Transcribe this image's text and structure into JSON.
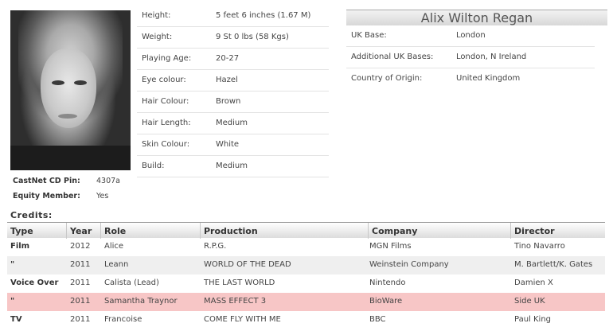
{
  "profile": {
    "name": "Alix Wilton Regan",
    "castnet_pin_label": "CastNet CD Pin:",
    "castnet_pin": "4307a",
    "equity_label": "Equity Member:",
    "equity": "Yes"
  },
  "attributes": [
    {
      "label": "Height:",
      "value": "5 feet 6 inches (1.67 M)"
    },
    {
      "label": "Weight:",
      "value": "9 St 0 lbs (58 Kgs)"
    },
    {
      "label": "Playing Age:",
      "value": "20-27"
    },
    {
      "label": "Eye colour:",
      "value": "Hazel"
    },
    {
      "label": "Hair Colour:",
      "value": "Brown"
    },
    {
      "label": "Hair Length:",
      "value": "Medium"
    },
    {
      "label": "Skin Colour:",
      "value": "White"
    },
    {
      "label": "Build:",
      "value": "Medium"
    }
  ],
  "bio": [
    {
      "label": "UK Base:",
      "value": "London"
    },
    {
      "label": "Additional UK Bases:",
      "value": "London, N Ireland"
    },
    {
      "label": "Country of Origin:",
      "value": "United Kingdom"
    }
  ],
  "credits": {
    "title": "Credits:",
    "headers": [
      "Type",
      "Year",
      "Role",
      "Production",
      "Company",
      "Director"
    ],
    "rows": [
      {
        "type": "Film",
        "year": "2012",
        "role": "Alice",
        "production": "R.P.G.",
        "company": "MGN Films",
        "director": "Tino Navarro"
      },
      {
        "type": "\"",
        "year": "2011",
        "role": "Leann",
        "production": "WORLD OF THE DEAD",
        "company": "Weinstein Company",
        "director": "M. Bartlett/K. Gates"
      },
      {
        "type": "Voice Over",
        "year": "2011",
        "role": "Calista (Lead)",
        "production": "THE LAST WORLD",
        "company": "Nintendo",
        "director": "Damien X"
      },
      {
        "type": "\"",
        "year": "2011",
        "role": "Samantha Traynor",
        "production": "MASS EFFECT 3",
        "company": "BioWare",
        "director": "Side UK"
      },
      {
        "type": "TV",
        "year": "2011",
        "role": "Francoise",
        "production": "COME FLY WITH ME",
        "company": "BBC",
        "director": "Paul King"
      }
    ]
  },
  "colors": {
    "highlight_row": "#f7c6c6",
    "alt_row": "#efefef"
  }
}
